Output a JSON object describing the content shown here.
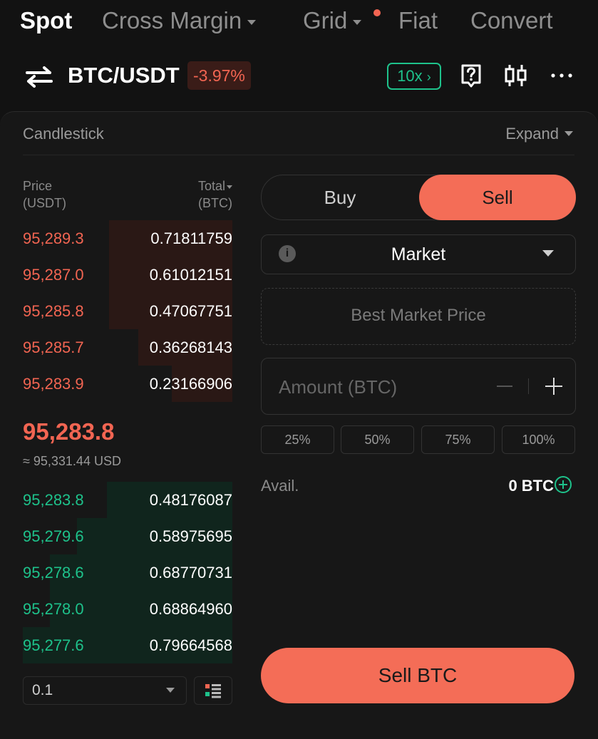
{
  "nav": {
    "tabs": [
      {
        "label": "Spot"
      },
      {
        "label": "Cross Margin"
      },
      {
        "label": "Grid"
      },
      {
        "label": "Fiat"
      },
      {
        "label": "Convert"
      }
    ]
  },
  "header": {
    "pair": "BTC/USDT",
    "change": "-3.97%",
    "leverage": "10x",
    "icons": [
      "swap-icon",
      "help-icon",
      "candlestick-chart-icon",
      "more-icon"
    ]
  },
  "chart_bar": {
    "label": "Candlestick",
    "expand": "Expand"
  },
  "orderbook": {
    "price_label": "Price",
    "price_unit": "(USDT)",
    "total_label": "Total",
    "total_unit": "(BTC)",
    "asks": [
      {
        "price": "95,289.3",
        "total": "0.71811759",
        "depth": 0.59
      },
      {
        "price": "95,287.0",
        "total": "0.61012151",
        "depth": 0.59
      },
      {
        "price": "95,285.8",
        "total": "0.47067751",
        "depth": 0.59
      },
      {
        "price": "95,285.7",
        "total": "0.36268143",
        "depth": 0.45
      },
      {
        "price": "95,283.9",
        "total": "0.23166906",
        "depth": 0.29
      }
    ],
    "mid_price": "95,283.8",
    "mid_usd": "≈ 95,331.44 USD",
    "bids": [
      {
        "price": "95,283.8",
        "total": "0.48176087",
        "depth": 0.6
      },
      {
        "price": "95,279.6",
        "total": "0.58975695",
        "depth": 0.74
      },
      {
        "price": "95,278.6",
        "total": "0.68770731",
        "depth": 0.87
      },
      {
        "price": "95,278.0",
        "total": "0.68864960",
        "depth": 0.87
      },
      {
        "price": "95,277.6",
        "total": "0.79664568",
        "depth": 1.0
      }
    ],
    "precision": "0.1"
  },
  "trade": {
    "buy_label": "Buy",
    "sell_label": "Sell",
    "order_type": "Market",
    "price_placeholder": "Best Market Price",
    "amount_placeholder": "Amount (BTC)",
    "percents": [
      "25%",
      "50%",
      "75%",
      "100%"
    ],
    "avail_label": "Avail.",
    "avail_value": "0 BTC",
    "submit_label": "Sell BTC"
  },
  "colors": {
    "sell": "#f46d57",
    "ask_text": "#f26552",
    "bid_text": "#1ec28b",
    "background": "#121212"
  }
}
